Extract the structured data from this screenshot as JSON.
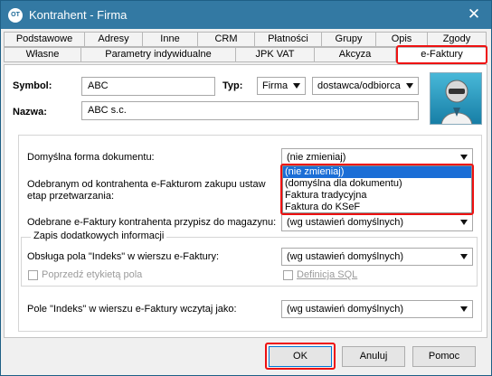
{
  "window": {
    "title": "Kontrahent - Firma",
    "app_icon_text": "OT",
    "close_glyph": "✕"
  },
  "tabs": {
    "row1": [
      "Podstawowe",
      "Adresy",
      "Inne",
      "CRM",
      "Płatności",
      "Grupy",
      "Opis",
      "Zgody"
    ],
    "row2": [
      "Własne",
      "Parametry indywidualne",
      "JPK VAT",
      "Akcyza",
      "e-Faktury"
    ],
    "active": "e-Faktury"
  },
  "form": {
    "symbol_label": "Symbol:",
    "symbol_value": "ABC",
    "typ_label": "Typ:",
    "typ_value": "Firma",
    "role_value": "dostawca/odbiorca",
    "nazwa_label": "Nazwa:",
    "nazwa_value": "ABC s.c."
  },
  "settings": {
    "default_form_label": "Domyślna forma dokumentu:",
    "default_form_value": "(nie zmieniaj)",
    "received_label_line1": "Odebranym od kontrahenta e-Fakturom zakupu ustaw",
    "received_label_line2": "etap przetwarzania:",
    "warehouse_label": "Odebrane e-Faktury kontrahenta przypisz do magazynu:",
    "warehouse_value": "(wg ustawień domyślnych)",
    "group_title": "Zapis dodatkowych informacji",
    "index_field_label": "Obsługa pola \"Indeks\" w wierszu e-Faktury:",
    "index_field_value": "(wg ustawień domyślnych)",
    "previous_label": "Poprzedź etykietą pola",
    "sql_definition_label": "Definicja SQL",
    "index_read_label": "Pole \"Indeks\" w wierszu e-Faktury wczytaj jako:",
    "index_read_value": "(wg ustawień domyślnych)"
  },
  "dropdown": {
    "options": [
      "(nie zmieniaj)",
      "(domyślna dla dokumentu)",
      "Faktura tradycyjna",
      "Faktura do KSeF"
    ],
    "selected_index": 0
  },
  "buttons": {
    "ok": "OK",
    "cancel": "Anuluj",
    "help": "Pomoc"
  },
  "colors": {
    "titlebar": "#3379a3",
    "highlight": "#e11111",
    "selection": "#1b6ed6"
  }
}
